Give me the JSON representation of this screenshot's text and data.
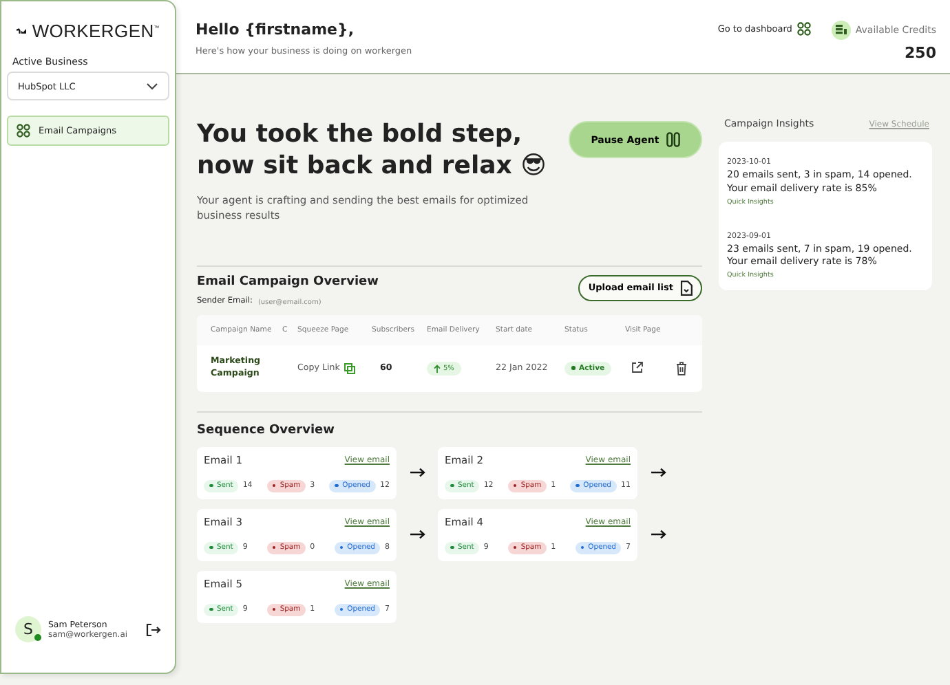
{
  "sidebar": {
    "logo": "WORKERGEN",
    "logo_mark": "™",
    "business_label": "Active Business",
    "business": "HubSpot LLC",
    "nav": [
      {
        "label": "Email Campaigns",
        "selected": true
      }
    ],
    "user": {
      "initial": "S",
      "online": true,
      "name": "Sam Peterson",
      "email": "sam@workergen.ai"
    }
  },
  "header": {
    "greeting": "Hello {firstname},",
    "subtitle": "Here's how your business is doing on workergen",
    "dashboard_link": "Go to dashboard",
    "credits_label": "Available Credits",
    "credits": "250"
  },
  "hero": {
    "title": "You took the bold step, now sit back and relax 😎",
    "text": "Your agent is crafting and sending the best emails for optimized business results",
    "pause_button": "Pause Agent"
  },
  "overview": {
    "title": "Email Campaign Overview",
    "sender_label": "Sender Email:",
    "sender": "(user@email.com)",
    "upload_button": "Upload email list",
    "columns": [
      "Campaign Name",
      "C",
      "Squeeze Page",
      "Subscribers",
      "Email Delivery",
      "Start date",
      "Status",
      "Visit Page"
    ],
    "rows": [
      {
        "name": "Marketing Campaign",
        "link": "Copy Link",
        "subscribers": "60",
        "delivery": "5%",
        "start": "22 Jan 2022",
        "status": "Active"
      }
    ]
  },
  "sequence": {
    "title": "Sequence Overview",
    "emails": [
      {
        "name": "Email 1",
        "link": "View email",
        "next_arrow": true,
        "stats": [
          {
            "kind": "sent",
            "label": "Sent",
            "count": "14"
          },
          {
            "kind": "spam",
            "label": "Spam",
            "count": "3"
          },
          {
            "kind": "opened",
            "label": "Opened",
            "count": "12"
          }
        ]
      },
      {
        "name": "Email 2",
        "link": "View email",
        "next_arrow": true,
        "stats": [
          {
            "kind": "sent",
            "label": "Sent",
            "count": "12"
          },
          {
            "kind": "spam",
            "label": "Spam",
            "count": "1"
          },
          {
            "kind": "opened",
            "label": "Opened",
            "count": "11"
          }
        ]
      },
      {
        "name": "Email 3",
        "link": "View email",
        "next_arrow": true,
        "stats": [
          {
            "kind": "sent",
            "label": "Sent",
            "count": "9"
          },
          {
            "kind": "spam",
            "label": "Spam",
            "count": "0"
          },
          {
            "kind": "opened",
            "label": "Opened",
            "count": "8"
          }
        ]
      },
      {
        "name": "Email 4",
        "link": "View email",
        "next_arrow": true,
        "stats": [
          {
            "kind": "sent",
            "label": "Sent",
            "count": "9"
          },
          {
            "kind": "spam",
            "label": "Spam",
            "count": "1"
          },
          {
            "kind": "opened",
            "label": "Opened",
            "count": "7"
          }
        ]
      },
      {
        "name": "Email 5",
        "link": "View email",
        "next_arrow": false,
        "stats": [
          {
            "kind": "sent",
            "label": "Sent",
            "count": "9"
          },
          {
            "kind": "spam",
            "label": "Spam",
            "count": "1"
          },
          {
            "kind": "opened",
            "label": "Opened",
            "count": "7"
          }
        ]
      }
    ]
  },
  "insights": {
    "title": "Campaign Insights",
    "schedule_link": "View Schedule",
    "items": [
      {
        "date": "2023-10-01",
        "text": "20 emails sent, 3 in spam, 14 opened. Your email delivery rate is 85%",
        "tag": "Quick Insights"
      },
      {
        "date": "2023-09-01",
        "text": "23 emails sent, 7 in spam, 19 opened. Your email delivery rate is 78%",
        "tag": "Quick Insights"
      }
    ]
  }
}
